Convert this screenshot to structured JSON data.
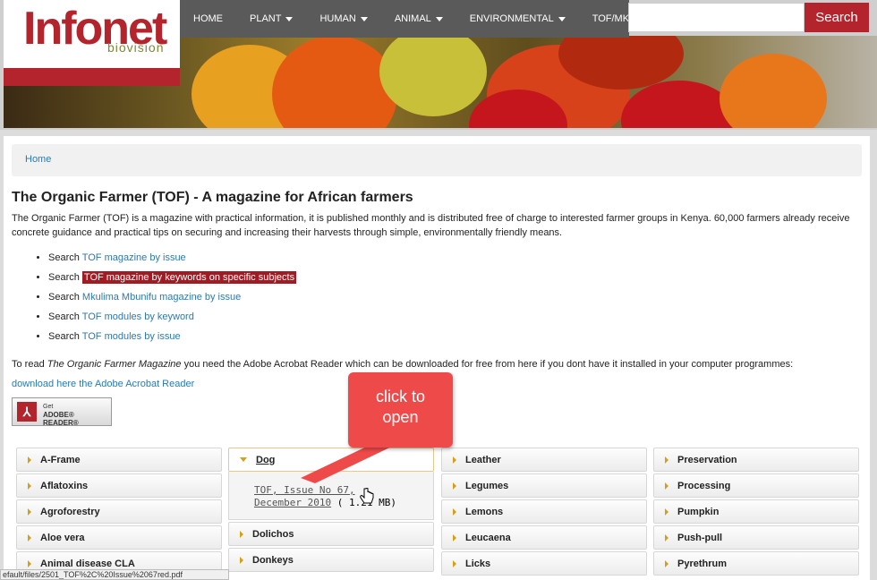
{
  "header": {
    "logo_text": "Infonet",
    "logo_sub": "biovision",
    "nav": [
      {
        "label": "HOME",
        "caret": false
      },
      {
        "label": "PLANT",
        "caret": true
      },
      {
        "label": "HUMAN",
        "caret": true
      },
      {
        "label": "ANIMAL",
        "caret": true
      },
      {
        "label": "ENVIRONMENTAL",
        "caret": true
      },
      {
        "label": "TOF/MKM",
        "caret": false
      }
    ],
    "search_placeholder": "",
    "search_button": "Search"
  },
  "breadcrumb": {
    "home": "Home"
  },
  "page": {
    "title": "The Organic Farmer (TOF) - A magazine for African farmers",
    "intro": "The Organic Farmer (TOF) is a magazine with practical information, it is published monthly and is distributed free of charge to interested farmer groups in Kenya. 60,000 farmers already receive concrete guidance and practical tips on securing and increasing their harvests through simple, environmentally friendly means.",
    "search_prefix": "Search",
    "bullets": [
      {
        "link": "TOF magazine by issue",
        "highlighted": false
      },
      {
        "link": "TOF magazine by keywords on specific subjects",
        "highlighted": true
      },
      {
        "link": "Mkulima Mbunifu magazine by issue",
        "highlighted": false
      },
      {
        "link": "TOF modules by keyword",
        "highlighted": false
      },
      {
        "link": "TOF modules by issue",
        "highlighted": false
      }
    ],
    "read_prefix": "To read ",
    "read_italic": "The Organic Farmer Magazine",
    "read_suffix": " you need the Adobe Acrobat Reader which can be downloaded for free from here if you dont have it installed in your computer programmes:",
    "download_link": "download here the Adobe Acrobat Reader",
    "adobe_badge": {
      "get": "Get",
      "reader": "ADOBE® READER®"
    }
  },
  "accordion": {
    "col1": [
      "A-Frame",
      "Aflatoxins",
      "Agroforestry",
      "Aloe vera",
      "Animal disease CLA"
    ],
    "col2_open": "Dog",
    "col2_panel": {
      "link": "TOF, Issue No 67, December 2010",
      "size": " ( 1.21 MB)"
    },
    "col2_rest": [
      "Dolichos",
      "Donkeys"
    ],
    "col3": [
      "Leather",
      "Legumes",
      "Lemons",
      "Leucaena",
      "Licks"
    ],
    "col4": [
      "Preservation",
      "Processing",
      "Pumpkin",
      "Push-pull",
      "Pyrethrum"
    ]
  },
  "callout": {
    "line1": "click to",
    "line2": "open"
  },
  "statusbar": "efault/files/2501_TOF%2C%20Issue%2067red.pdf",
  "colors": {
    "brand_red": "#b3242d",
    "nav_gray": "#5a5a5a",
    "link_blue": "#2a7ab0",
    "callout_red": "#ef4a4a",
    "accent_gold": "#d4a017"
  }
}
